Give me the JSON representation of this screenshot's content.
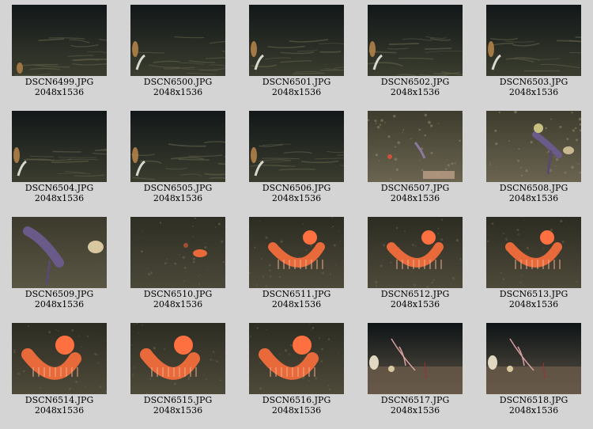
{
  "gallery": {
    "items": [
      {
        "filename": "DSCN6499.JPG",
        "dimensions": "2048x1536",
        "scene": "dark"
      },
      {
        "filename": "DSCN6500.JPG",
        "dimensions": "2048x1536",
        "scene": "dark-sponge"
      },
      {
        "filename": "DSCN6501.JPG",
        "dimensions": "2048x1536",
        "scene": "dark-sponge"
      },
      {
        "filename": "DSCN6502.JPG",
        "dimensions": "2048x1536",
        "scene": "dark-sponge"
      },
      {
        "filename": "DSCN6503.JPG",
        "dimensions": "2048x1536",
        "scene": "dark-sponge"
      },
      {
        "filename": "DSCN6504.JPG",
        "dimensions": "2048x1536",
        "scene": "dark-sponge"
      },
      {
        "filename": "DSCN6505.JPG",
        "dimensions": "2048x1536",
        "scene": "dark-sponge"
      },
      {
        "filename": "DSCN6506.JPG",
        "dimensions": "2048x1536",
        "scene": "dark-sponge"
      },
      {
        "filename": "DSCN6507.JPG",
        "dimensions": "2048x1536",
        "scene": "seafloor-lit"
      },
      {
        "filename": "DSCN6508.JPG",
        "dimensions": "2048x1536",
        "scene": "seafloor-coral"
      },
      {
        "filename": "DSCN6509.JPG",
        "dimensions": "2048x1536",
        "scene": "purple-coral"
      },
      {
        "filename": "DSCN6510.JPG",
        "dimensions": "2048x1536",
        "scene": "small-anemone"
      },
      {
        "filename": "DSCN6511.JPG",
        "dimensions": "2048x1536",
        "scene": "anemone"
      },
      {
        "filename": "DSCN6512.JPG",
        "dimensions": "2048x1536",
        "scene": "anemone"
      },
      {
        "filename": "DSCN6513.JPG",
        "dimensions": "2048x1536",
        "scene": "anemone"
      },
      {
        "filename": "DSCN6514.JPG",
        "dimensions": "2048x1536",
        "scene": "anemone-close"
      },
      {
        "filename": "DSCN6515.JPG",
        "dimensions": "2048x1536",
        "scene": "anemone-close"
      },
      {
        "filename": "DSCN6516.JPG",
        "dimensions": "2048x1536",
        "scene": "anemone-close"
      },
      {
        "filename": "DSCN6517.JPG",
        "dimensions": "2048x1536",
        "scene": "whip-coral"
      },
      {
        "filename": "DSCN6518.JPG",
        "dimensions": "2048x1536",
        "scene": "whip-coral"
      }
    ]
  },
  "colors": {
    "page_background": "#d4d4d4",
    "caption_text": "#000000",
    "dark_water": "#141a1c",
    "seafloor": "#4a4a38",
    "anemone_orange": "#e86a3a",
    "coral_purple": "#6a5a8a"
  }
}
